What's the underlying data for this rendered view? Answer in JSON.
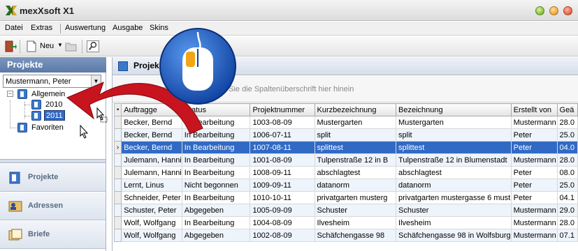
{
  "app": {
    "title": "mexXsoft X1"
  },
  "window_buttons": [
    "minimize-button",
    "maximize-button",
    "close-button"
  ],
  "colors": {
    "selection": "#316ac5",
    "sidebar_header": "#6a86b3",
    "arrow": "#c8141e",
    "overlay_blue": "#1f5fbf"
  },
  "menu": [
    "Datei",
    "Extras",
    "Auswertung",
    "Ausgabe",
    "Skins"
  ],
  "toolbar": {
    "new_label": "Neu"
  },
  "sidebar": {
    "title": "Projekte",
    "user_select": "Mustermann, Peter",
    "tree": {
      "root": "Allgemein",
      "years": [
        "2010",
        "2011"
      ],
      "selected": "2011",
      "favorites": "Favoriten"
    },
    "nav": [
      "Projekte",
      "Adressen",
      "Briefe"
    ]
  },
  "main": {
    "panel_title": "Projek",
    "group_hint": "Um nach einer Sp                       ieren, ziehen Sie die Spaltenüberschrift hier hinein"
  },
  "grid": {
    "columns": [
      "Auftragge",
      "Status",
      "Projektnummer",
      "Kurzbezeichnung",
      "Bezeichnung",
      "Erstellt von",
      "Geä"
    ],
    "selected_row": 2,
    "rows": [
      [
        "Becker, Bernd",
        "In Bearbeitung",
        "1003-08-09",
        "Mustergarten",
        "Mustergarten",
        "Mustermann",
        "28.0"
      ],
      [
        "Becker, Bernd",
        "In Bearbeitung",
        "1006-07-11",
        "split",
        "split",
        "Peter",
        "25.0"
      ],
      [
        "Becker, Bernd",
        "In Bearbeitung",
        "1007-08-11",
        "splittest",
        "splittest",
        "Peter",
        "04.0"
      ],
      [
        "Julemann, Hanni",
        "In Bearbeitung",
        "1001-08-09",
        "Tulpenstraße 12 in B",
        "Tulpenstraße 12 in Blumenstadt",
        "Mustermann",
        "28.0"
      ],
      [
        "Julemann, Hanni",
        "In Bearbeitung",
        "1008-09-11",
        "abschlagtest",
        "abschlagtest",
        "Peter",
        "08.0"
      ],
      [
        "Lernt, Linus",
        "Nicht begonnen",
        "1009-09-11",
        "datanorm",
        "datanorm",
        "Peter",
        "25.0"
      ],
      [
        "Schneider, Peter",
        "In Bearbeitung",
        "1010-10-11",
        "privatgarten musterg",
        "privatgarten mustergasse 6 must",
        "Peter",
        "04.1"
      ],
      [
        "Schuster, Peter",
        "Abgegeben",
        "1005-09-09",
        "Schuster",
        "Schuster",
        "Mustermann",
        "29.0"
      ],
      [
        "Wolf, Wolfgang",
        "In Bearbeitung",
        "1004-08-09",
        "Ilvesheim",
        "Ilvesheim",
        "Mustermann",
        "28.0"
      ],
      [
        "Wolf, Wolfgang",
        "Abgegeben",
        "1002-08-09",
        "Schäfchengasse 98",
        "Schäfchengasse 98 in Wolfsburg",
        "Mustermann",
        "07.1"
      ]
    ]
  }
}
